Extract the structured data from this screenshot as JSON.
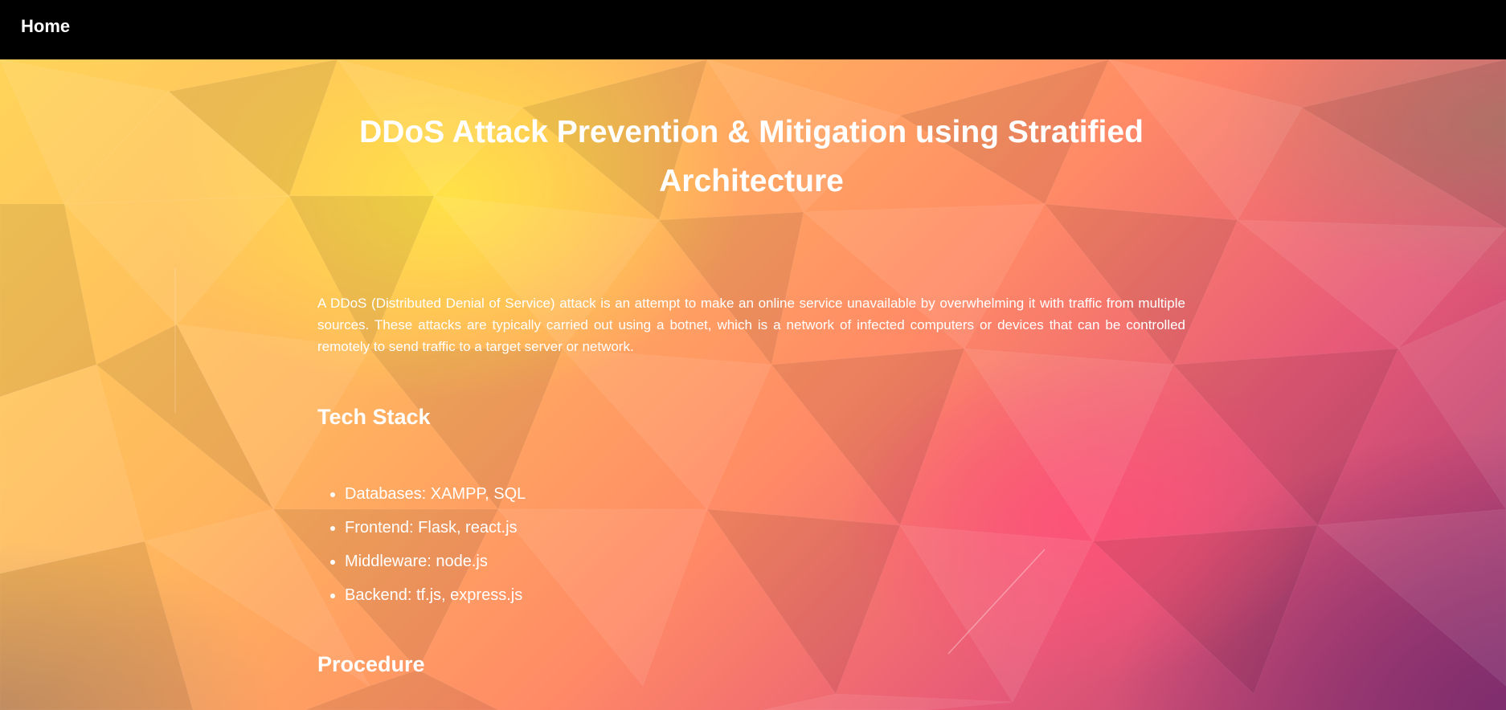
{
  "nav": {
    "home_label": "Home"
  },
  "main": {
    "title": "DDoS Attack Prevention & Mitigation using Stratified Architecture",
    "intro": "A DDoS (Distributed Denial of Service) attack is an attempt to make an online service unavailable by overwhelming it with traffic from multiple sources. These attacks are typically carried out using a botnet, which is a network of infected computers or devices that can be controlled remotely to send traffic to a target server or network.",
    "tech_stack": {
      "heading": "Tech Stack",
      "items": [
        "Databases: XAMPP, SQL",
        "Frontend: Flask, react.js",
        "Middleware: node.js",
        "Backend: tf.js, express.js"
      ]
    },
    "procedure": {
      "heading": "Procedure"
    }
  },
  "colors": {
    "navbar_bg": "#000000",
    "text": "#ffffff",
    "background_top_left": "#ffd45a",
    "background_center": "#ff8a66",
    "background_bottom_right": "#a0386f"
  }
}
